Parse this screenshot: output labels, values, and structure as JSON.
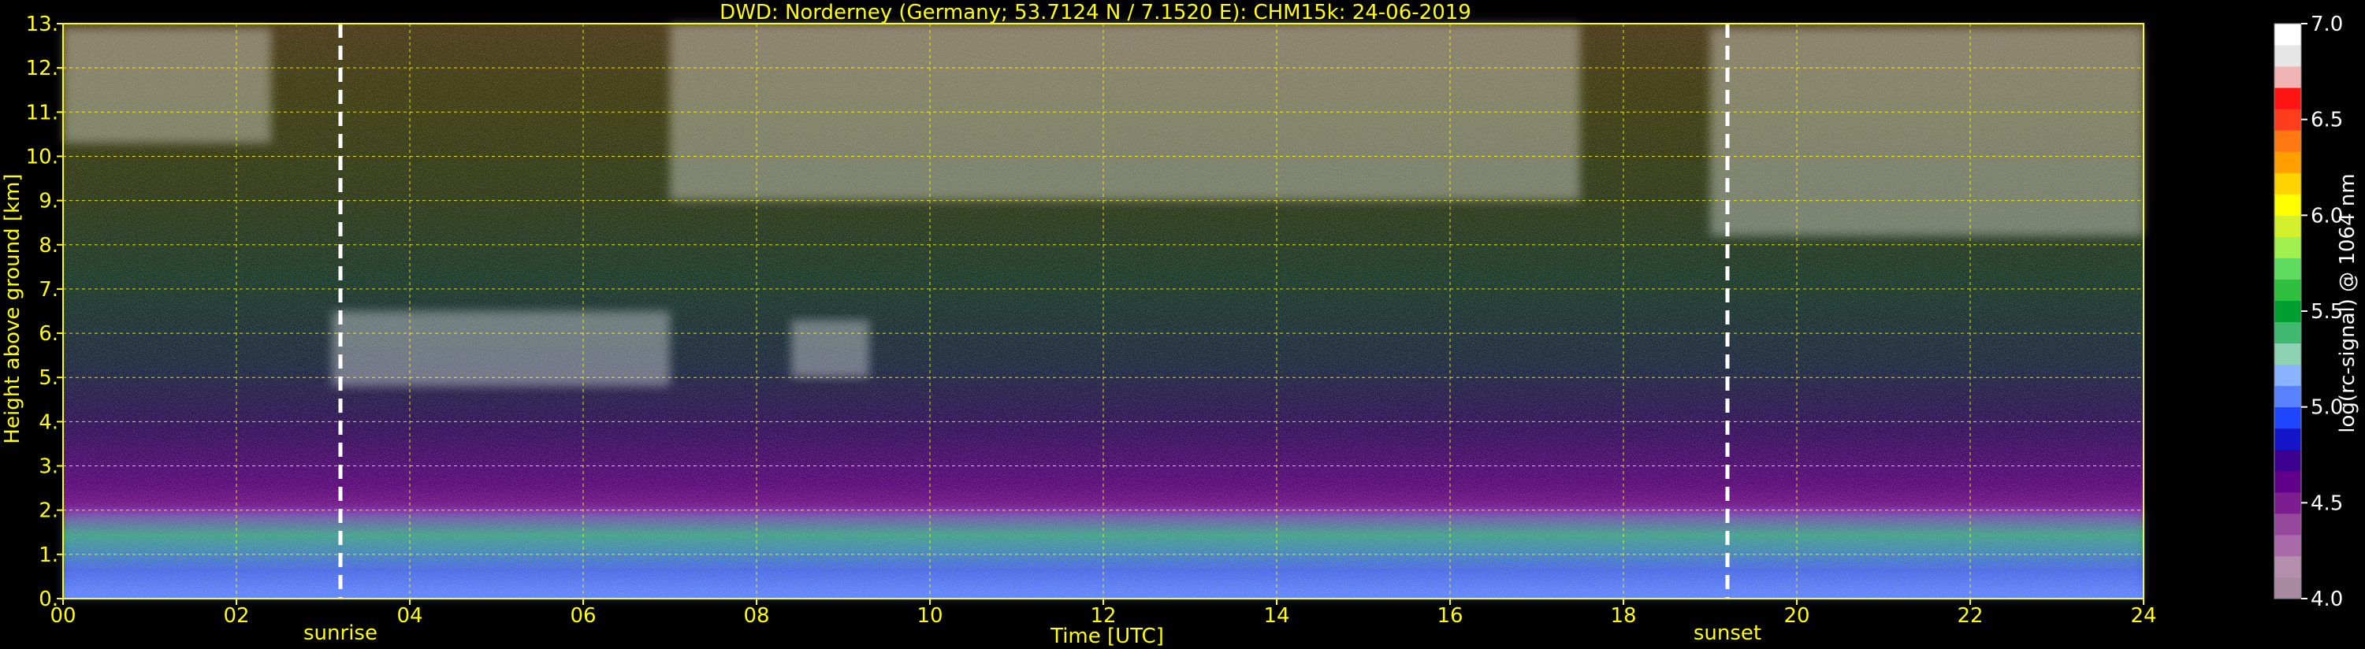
{
  "title": "DWD: Norderney (Germany; 53.7124 N / 7.1520 E):    CHM15k: 24-06-2019",
  "chart_data": {
    "type": "heatmap",
    "xlabel": "Time [UTC]",
    "ylabel": "Height above ground [km]",
    "xlim": [
      0,
      24
    ],
    "ylim": [
      0,
      13
    ],
    "x_ticks": [
      "00",
      "02",
      "04",
      "06",
      "08",
      "10",
      "12",
      "14",
      "16",
      "18",
      "20",
      "22",
      "24"
    ],
    "y_ticks": [
      "0.",
      "1.",
      "2.",
      "3.",
      "4.",
      "5.",
      "6.",
      "7.",
      "8.",
      "9.",
      "10.",
      "11.",
      "12.",
      "13."
    ],
    "grid": true,
    "markers": [
      {
        "label": "sunrise",
        "x": 3.2
      },
      {
        "label": "sunset",
        "x": 19.2
      }
    ],
    "colorbar": {
      "label": "log(rc-signal) @ 1064 nm",
      "range": [
        4.0,
        7.0
      ],
      "ticks": [
        "4.0",
        "4.5",
        "5.0",
        "5.5",
        "6.0",
        "6.5",
        "7.0"
      ],
      "colors": [
        "#a88aa0",
        "#b590ae",
        "#a86aa8",
        "#96489c",
        "#7d1e90",
        "#60008a",
        "#3c0090",
        "#1414c8",
        "#1e46ff",
        "#5a82ff",
        "#8ab4ff",
        "#8ed2b4",
        "#40b870",
        "#00a030",
        "#30c040",
        "#60dc60",
        "#a0f050",
        "#d4f02c",
        "#ffff00",
        "#ffd200",
        "#ffa000",
        "#ff7814",
        "#ff3c1e",
        "#ff1414",
        "#f0b4b4",
        "#e6e6e6",
        "#ffffff"
      ]
    },
    "features": [
      {
        "type": "cloud",
        "x": [
          0.0,
          2.4
        ],
        "y": [
          10.3,
          12.9
        ]
      },
      {
        "type": "cloud",
        "x": [
          3.1,
          7.0
        ],
        "y": [
          4.8,
          6.5
        ]
      },
      {
        "type": "cloud",
        "x": [
          8.4,
          9.3
        ],
        "y": [
          5.0,
          6.3
        ]
      },
      {
        "type": "cloud",
        "x": [
          7.0,
          17.5
        ],
        "y": [
          9.0,
          13.0
        ]
      },
      {
        "type": "cloud",
        "x": [
          19.0,
          24.0
        ],
        "y": [
          8.2,
          12.9
        ]
      },
      {
        "type": "boundary-layer",
        "x": [
          0.0,
          24.0
        ],
        "y": [
          0.0,
          2.0
        ]
      }
    ]
  }
}
